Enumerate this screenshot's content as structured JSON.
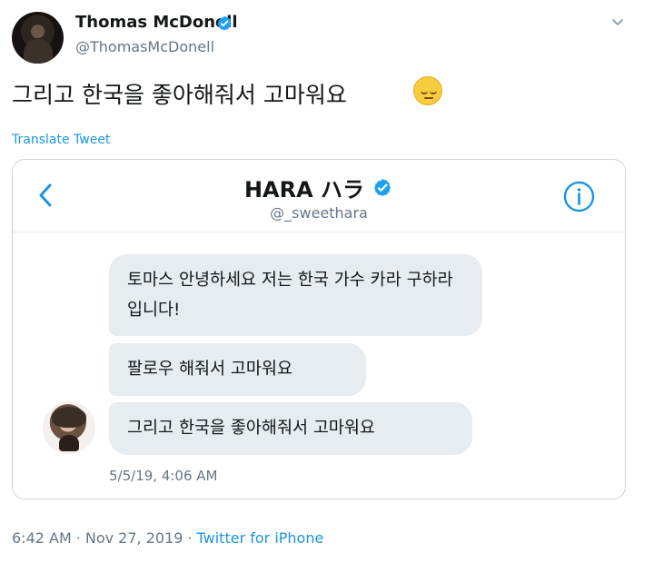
{
  "tweet": {
    "author_name": "Thomas McDonell",
    "author_handle": "@ThomasMcDonell",
    "verified_icon": "verified-badge-icon",
    "menu_icon": "chevron-down-icon",
    "text": "그리고 한국을 좋아해줘서 고마워요",
    "emoji": "pensive-face-icon",
    "translate_link": "Translate Tweet",
    "posted_time": "6:42 AM",
    "posted_date": "Nov 27, 2019",
    "source": "Twitter for iPhone"
  },
  "dm": {
    "title": "HARA ハラ",
    "handle": "@_sweethara",
    "back_icon": "chevron-left-icon",
    "info_icon": "info-icon",
    "messages": [
      {
        "text": "토마스 안녕하세요 저는 한국 가수 카라 구하라입니다!"
      },
      {
        "text": "팔로우 해줘서 고마워요"
      },
      {
        "text": "그리고 한국을 좋아해줘서 고마워요"
      }
    ],
    "timestamp": "5/5/19, 4:06 AM"
  },
  "colors": {
    "accent": "#1b95e0",
    "muted": "#657786",
    "bubble": "#e6ecf0",
    "border": "#ccd6dd"
  }
}
